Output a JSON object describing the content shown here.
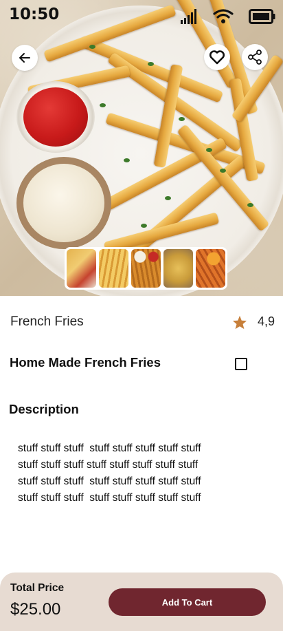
{
  "status_bar": {
    "time": "10:50",
    "icons": [
      "signal-icon",
      "wifi-icon",
      "battery-icon"
    ]
  },
  "hero": {
    "thumbnails": [
      "fries-with-dips",
      "fries-in-tray",
      "fries-with-sauces",
      "loaded-fries",
      "sweet-potato-fries"
    ]
  },
  "product": {
    "name": "French Fries",
    "rating": "4,9",
    "headline": "Home Made French Fries"
  },
  "description": {
    "title": "Description",
    "lines": [
      "stuff stuff stuff  stuff stuff stuff stuff stuff",
      "stuff stuff stuff stuff stuff stuff stuff stuff",
      "stuff stuff stuff  stuff stuff stuff stuff stuff",
      "stuff stuff stuff  stuff stuff stuff stuff stuff"
    ]
  },
  "footer": {
    "total_label": "Total Price",
    "total_price": "$25.00",
    "cart_label": "Add To Cart"
  },
  "colors": {
    "accent": "#70262f",
    "footer_bg": "#e7dbd2",
    "star": "#c77f3a"
  }
}
